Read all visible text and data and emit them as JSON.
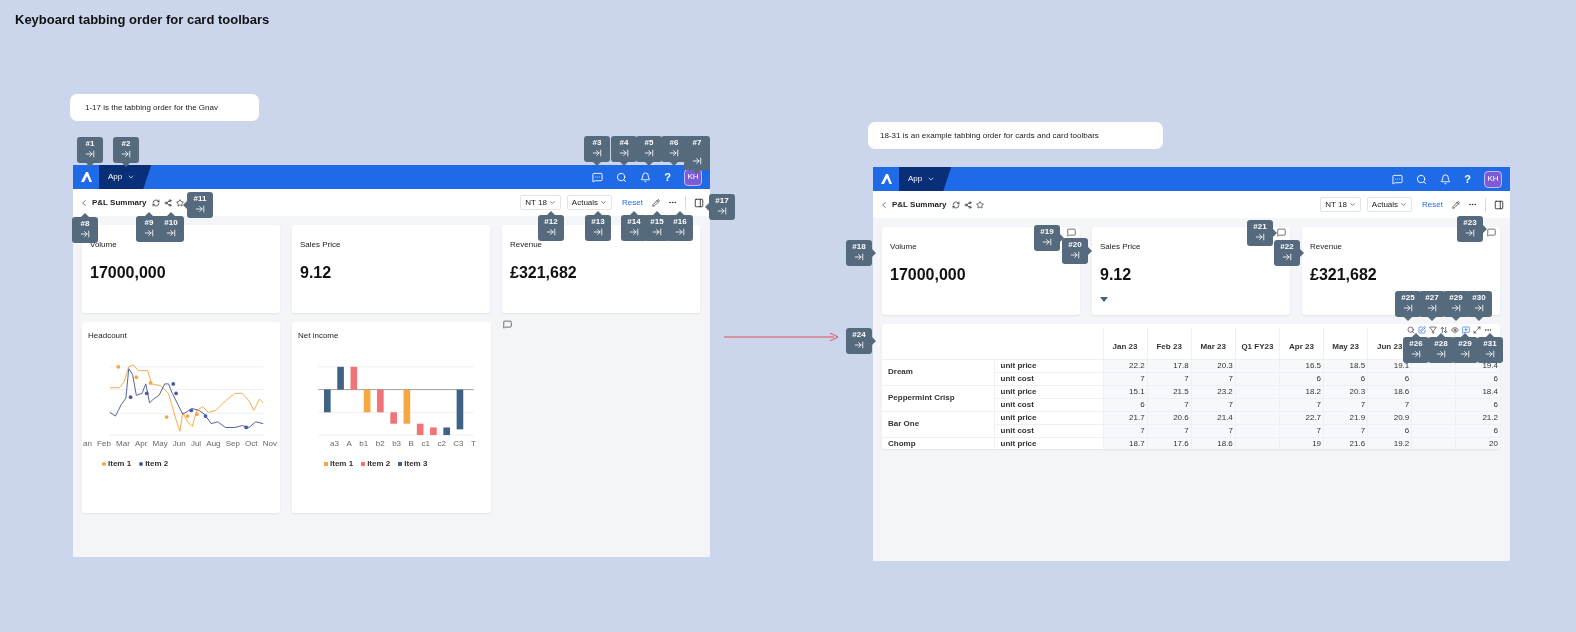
{
  "title": "Keyboard tabbing order for card toolbars",
  "notes": [
    "1-17 is the tabbing order for the Gnav",
    "18-31 is an example tabbing order for cards and card toolbars"
  ],
  "frames": [
    {
      "nav": {
        "app": "App",
        "help": "?",
        "avatar": "KH"
      },
      "subheader": {
        "title": "P&L Summary",
        "dropdowns": [
          "NT 18",
          "Actuals"
        ],
        "reset": "Reset"
      },
      "cards": [
        {
          "title": "Volume",
          "value": "17000,000"
        },
        {
          "title": "Sales Price",
          "value": "9.12"
        },
        {
          "title": "Revenue",
          "value": "£321,682"
        }
      ],
      "headcount": {
        "title": "Headcount",
        "x_labels": [
          "an",
          "Feb",
          "Mar",
          "Apr",
          "May",
          "Jun",
          "Jul",
          "Aug",
          "Sep",
          "Oct",
          "Nov"
        ],
        "legend": [
          {
            "label": "Item 1",
            "color": "#f5a742"
          },
          {
            "label": "Item 2",
            "color": "#4b5a9a"
          }
        ]
      },
      "net_income": {
        "title": "Net income",
        "x_labels": [
          "a3",
          "A",
          "b1",
          "b2",
          "b3",
          "B",
          "c1",
          "c2",
          "C3",
          "T"
        ],
        "legend": [
          {
            "label": "Item 1",
            "color": "#f5a742"
          },
          {
            "label": "Item 2",
            "color": "#f07378"
          },
          {
            "label": "Item 3",
            "color": "#3f6285"
          }
        ]
      }
    },
    {
      "nav": {
        "app": "App",
        "help": "?",
        "avatar": "KH"
      },
      "subheader": {
        "title": "P&L Summary",
        "dropdowns": [
          "NT 18",
          "Actuals"
        ],
        "reset": "Reset"
      },
      "cards": [
        {
          "title": "Volume",
          "value": "17000,000"
        },
        {
          "title": "Sales Price",
          "value": "9.12"
        },
        {
          "title": "Revenue",
          "value": "£321,682"
        }
      ],
      "table": {
        "columns": [
          {
            "label": "Jan 23",
            "kind": "data"
          },
          {
            "label": "Feb 23",
            "kind": "data"
          },
          {
            "label": "Mar 23",
            "kind": "data"
          },
          {
            "label": "Q1 FY23",
            "kind": "empty"
          },
          {
            "label": "Apr 23",
            "kind": "data"
          },
          {
            "label": "May 23",
            "kind": "data"
          },
          {
            "label": "Jun 23",
            "kind": "data"
          },
          {
            "kind": "empty"
          },
          {
            "kind": "data"
          }
        ],
        "groups": [
          {
            "name": "Dream",
            "rows": [
              {
                "measure": "unit price",
                "values": [
                  "22.2",
                  "17.8",
                  "20.3",
                  "16.5",
                  "18.5",
                  "19.1",
                  "19.4"
                ]
              },
              {
                "measure": "unit cost",
                "values": [
                  "7",
                  "7",
                  "7",
                  "6",
                  "6",
                  "6",
                  "6"
                ]
              }
            ]
          },
          {
            "name": "Peppermint Crisp",
            "rows": [
              {
                "measure": "unit price",
                "values": [
                  "15.1",
                  "21.5",
                  "23.2",
                  "18.2",
                  "20.3",
                  "18.6",
                  "18.4"
                ]
              },
              {
                "measure": "unit cost",
                "values": [
                  "6",
                  "7",
                  "7",
                  "7",
                  "7",
                  "7",
                  "6"
                ]
              }
            ]
          },
          {
            "name": "Bar One",
            "rows": [
              {
                "measure": "unit price",
                "values": [
                  "21.7",
                  "20.6",
                  "21.4",
                  "22.7",
                  "21.9",
                  "20.9",
                  "21.2"
                ]
              },
              {
                "measure": "unit cost",
                "values": [
                  "7",
                  "7",
                  "7",
                  "7",
                  "7",
                  "6",
                  "6"
                ]
              }
            ]
          },
          {
            "name": "Chomp",
            "rows": [
              {
                "measure": "unit price",
                "values": [
                  "18.7",
                  "17.6",
                  "18.6",
                  "19",
                  "21.6",
                  "19.2",
                  "20"
                ]
              }
            ]
          }
        ]
      }
    }
  ],
  "callouts": [
    "#1",
    "#2",
    "#3",
    "#4",
    "#5",
    "#6",
    "#7",
    "#8",
    "#9",
    "#10",
    "#11",
    "#12",
    "#13",
    "#14",
    "#15",
    "#16",
    "#17",
    "#18",
    "#19",
    "#20",
    "#21",
    "#22",
    "#23",
    "#24",
    "#25",
    "#27",
    "#29",
    "#30",
    "#26",
    "#28",
    "#29",
    "#31"
  ]
}
